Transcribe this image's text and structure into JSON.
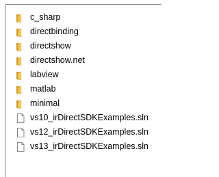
{
  "explorer": {
    "items": [
      {
        "name": "c_sharp",
        "type": "folder"
      },
      {
        "name": "directbinding",
        "type": "folder"
      },
      {
        "name": "directshow",
        "type": "folder"
      },
      {
        "name": "directshow.net",
        "type": "folder"
      },
      {
        "name": "labview",
        "type": "folder"
      },
      {
        "name": "matlab",
        "type": "folder"
      },
      {
        "name": "minimal",
        "type": "folder"
      },
      {
        "name": "vs10_irDirectSDKExamples.sln",
        "type": "file"
      },
      {
        "name": "vs12_irDirectSDKExamples.sln",
        "type": "file"
      },
      {
        "name": "vs13_irDirectSDKExamples.sln",
        "type": "file"
      }
    ]
  },
  "colors": {
    "folder_body": "#e9b84c",
    "folder_back": "#d69b2a",
    "file_border": "#8a8a8a",
    "text": "#000000"
  }
}
